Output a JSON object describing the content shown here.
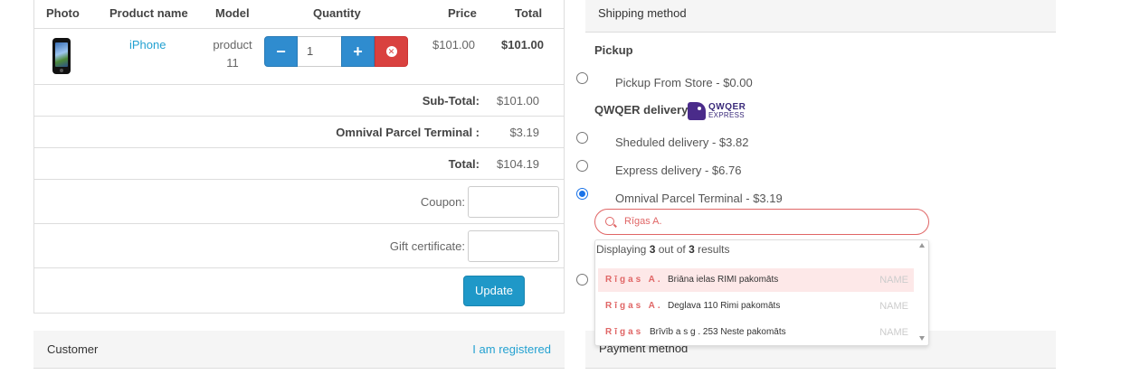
{
  "cart": {
    "headers": {
      "photo": "Photo",
      "product_name": "Product name",
      "model": "Model",
      "quantity": "Quantity",
      "price": "Price",
      "total": "Total"
    },
    "item": {
      "name": "iPhone",
      "model": "product 11",
      "quantity": "1",
      "price": "$101.00",
      "total": "$101.00"
    },
    "totals": [
      {
        "label": "Sub-Total:",
        "value": "$101.00"
      },
      {
        "label": "Omnival Parcel Terminal :",
        "value": "$3.19"
      },
      {
        "label": "Total:",
        "value": "$104.19"
      }
    ],
    "coupon_label": "Coupon:",
    "gift_label": "Gift certificate:",
    "update_label": "Update"
  },
  "customer": {
    "title": "Customer",
    "link": "I am registered"
  },
  "shipping": {
    "title": "Shipping method",
    "pickup_group": "Pickup",
    "pickup_option": "Pickup From Store - $0.00",
    "qwqer_group": "QWQER delivery",
    "qwqer_logo": {
      "line1": "QWQER",
      "line2": "EXPRESS"
    },
    "qwqer_options": [
      "Sheduled delivery - $3.82",
      "Express delivery - $6.76",
      "Omnival Parcel Terminal - $3.19"
    ],
    "selected": "Omnival Parcel Terminal - $3.19",
    "search_value": "Rīgas A.",
    "results": {
      "prefix": "Displaying",
      "shown": "3",
      "middle": "out of",
      "total": "3",
      "suffix": "results"
    },
    "terminals": [
      {
        "match": "Rīgas A.",
        "rest": "Briāna ielas RIMI pakomāts",
        "tag": "NAME"
      },
      {
        "match": "Rīgas A.",
        "rest": "Deglava 110 Rimi pakomāts",
        "tag": "NAME"
      },
      {
        "match": "Rīgas",
        "rest": "Brīvīb a s g .  253 Neste pakomāts",
        "tag": "NAME"
      }
    ]
  },
  "payment": {
    "title": "Payment method"
  },
  "colors": {
    "accent_blue": "#2f8ccf",
    "link_blue": "#23a1d1",
    "danger_red": "#d9413f",
    "search_highlight": "#e06666"
  }
}
